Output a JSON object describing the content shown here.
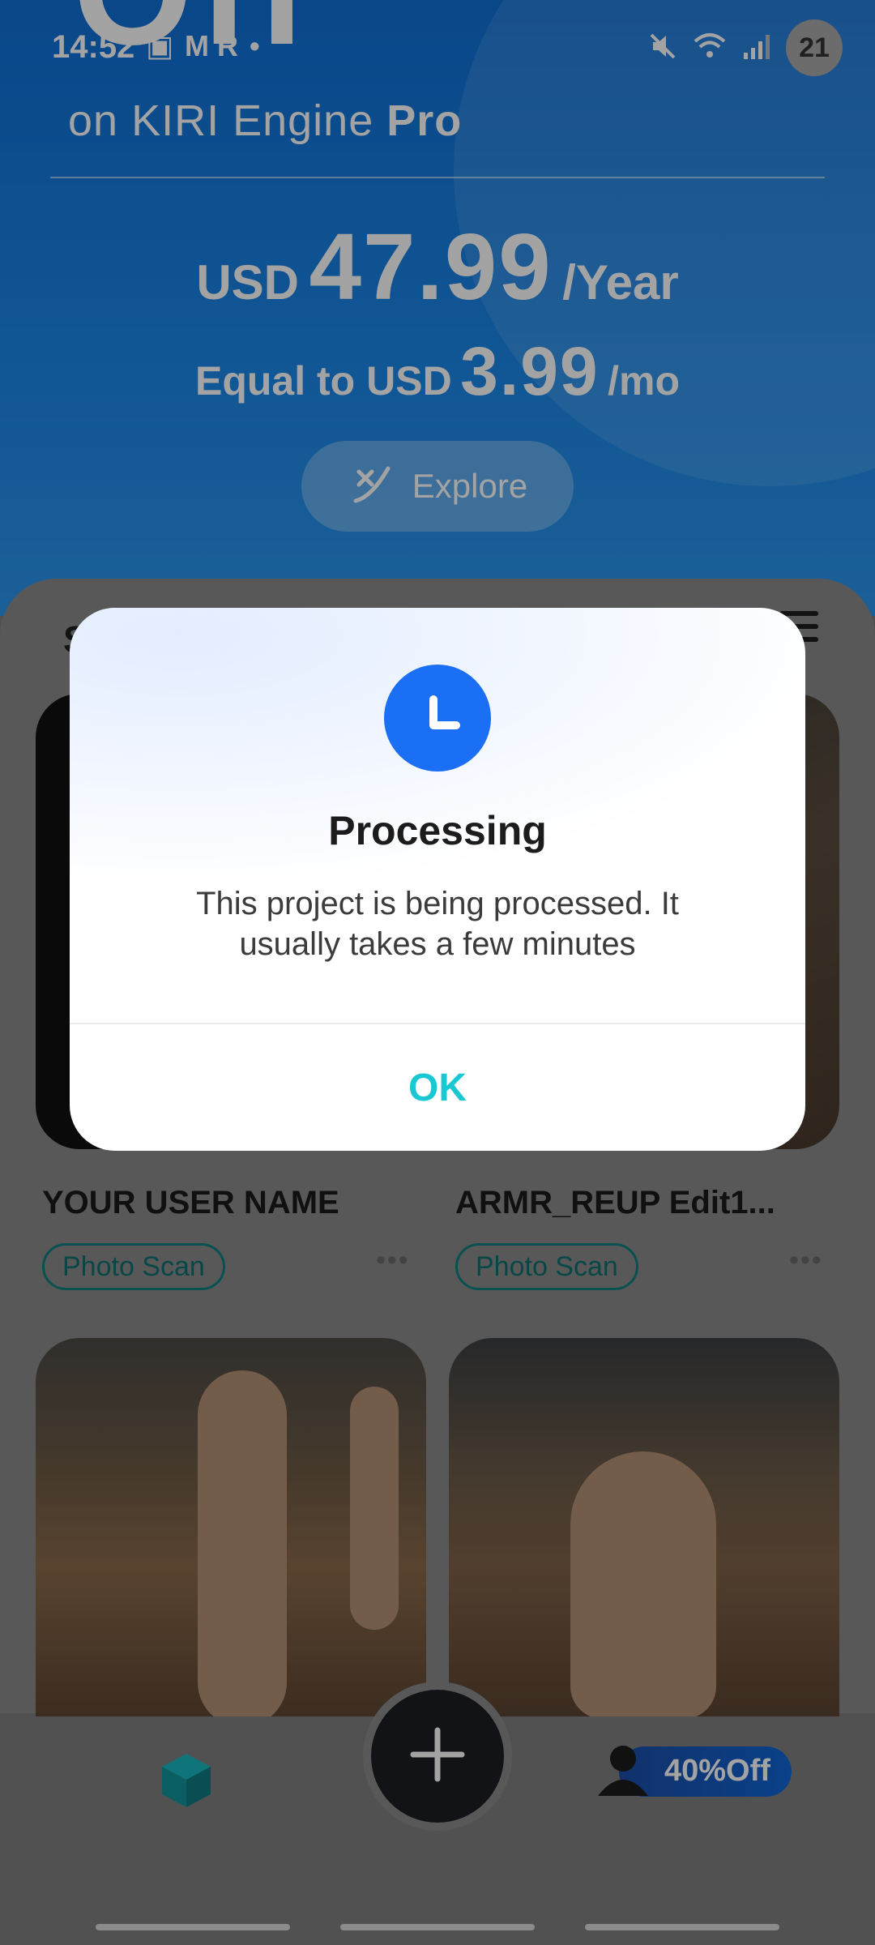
{
  "status_bar": {
    "time": "14:52",
    "notification_letters": "M  R",
    "battery": "21"
  },
  "promo": {
    "big_letters": "Off",
    "line_prefix": "on KIRI Engine",
    "line_bold": "Pro",
    "currency": "USD",
    "price": "47.99",
    "period": "/Year",
    "equal_prefix": "Equal to USD",
    "monthly_price": "3.99",
    "monthly_period": "/mo",
    "explore_label": "Explore"
  },
  "projects": {
    "section_title": "S",
    "items": [
      {
        "name": "YOUR USER NAME",
        "type": "Photo Scan"
      },
      {
        "name": "ARMR_REUP Edit1...",
        "type": "Photo Scan"
      }
    ]
  },
  "bottom_nav": {
    "offer_label": "40%Off"
  },
  "dialog": {
    "title": "Processing",
    "message": "This project is being processed. It usually takes a few minutes",
    "ok_label": "OK"
  },
  "colors": {
    "accent_teal": "#19c8d2",
    "clock_blue": "#1a6ff5",
    "promo_blue": "#1a86e8"
  }
}
